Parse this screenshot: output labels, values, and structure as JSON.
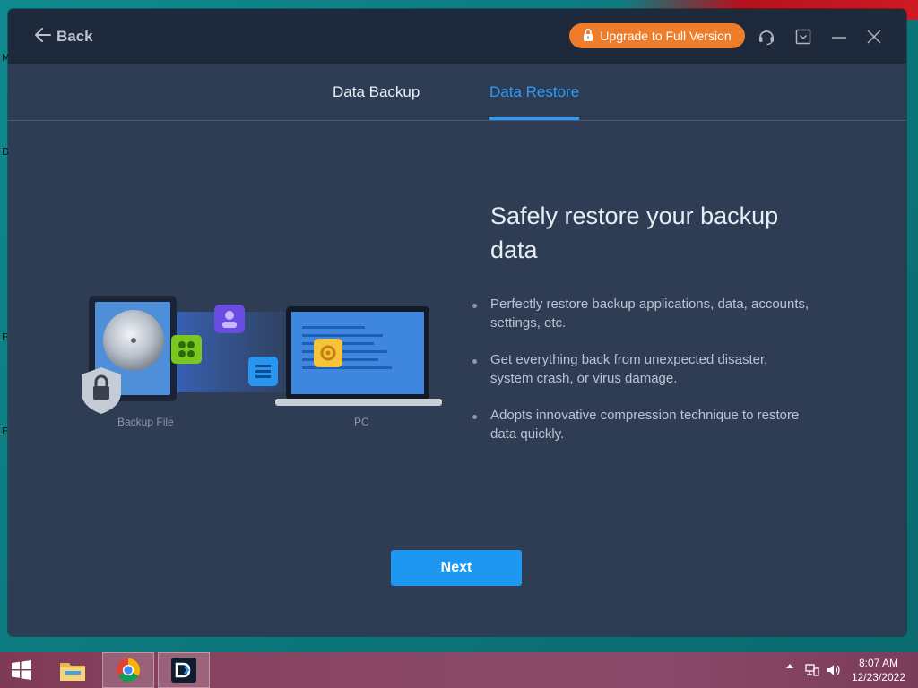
{
  "window": {
    "back_label": "Back",
    "upgrade_label": "Upgrade to Full Version"
  },
  "tabs": [
    {
      "label": "Data Backup",
      "active": false
    },
    {
      "label": "Data Restore",
      "active": true
    }
  ],
  "illustration": {
    "backup_caption": "Backup File",
    "pc_caption": "PC"
  },
  "content": {
    "headline": "Safely restore your backup data",
    "bullets": [
      "Perfectly restore backup applications, data, accounts, settings, etc.",
      "Get everything back from unexpected disaster, system crash, or virus damage.",
      "Adopts innovative compression technique to restore data quickly."
    ]
  },
  "next_label": "Next",
  "colors": {
    "accent_blue": "#2f9bf4",
    "upgrade_orange": "#ee7d2b",
    "window_bg": "#2f3d54",
    "titlebar_bg": "#1e2a3b"
  },
  "desktop": {
    "edge_letters": [
      "M",
      "D",
      "E",
      "E"
    ]
  },
  "taskbar": {
    "time": "8:07 AM",
    "date": "12/23/2022",
    "apps": [
      "start-icon",
      "file-explorer-icon",
      "chrome-icon",
      "backup-app-icon"
    ]
  }
}
